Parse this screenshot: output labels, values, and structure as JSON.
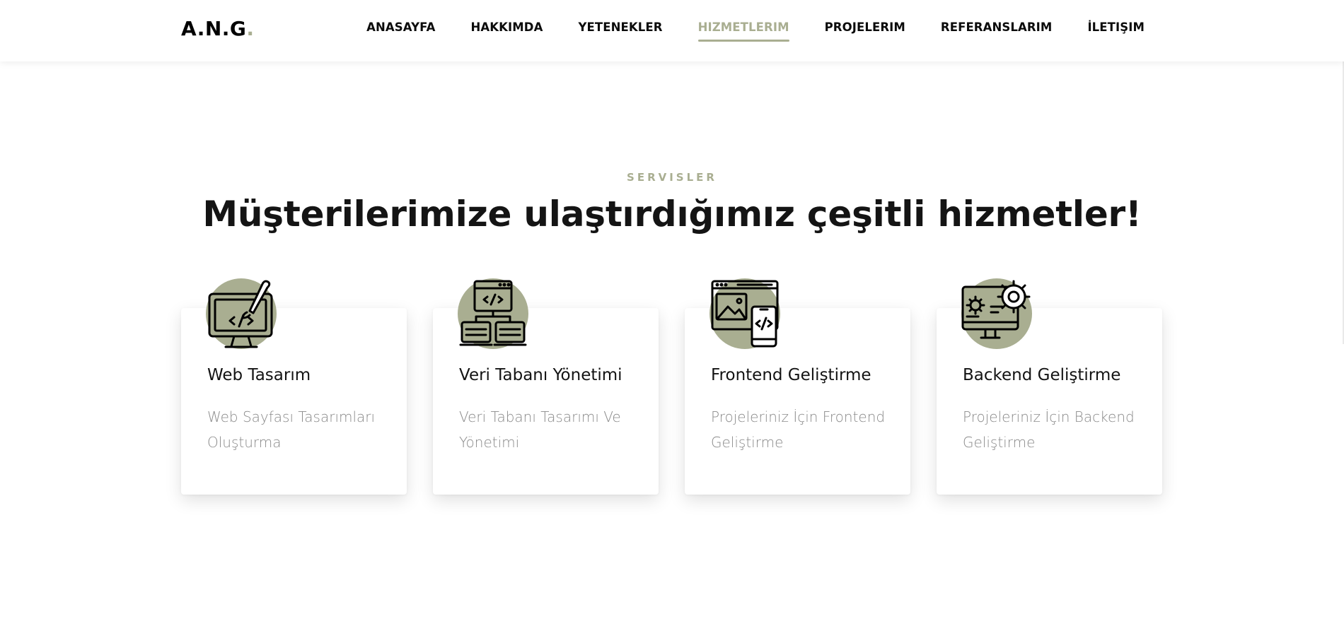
{
  "header": {
    "logo": {
      "text": "A.N.G",
      "dot": "."
    },
    "nav": [
      {
        "label": "ANASAYFA",
        "active": false
      },
      {
        "label": "HAKKIMDA",
        "active": false
      },
      {
        "label": "YETENEKLER",
        "active": false
      },
      {
        "label": "HIZMETLERIM",
        "active": true
      },
      {
        "label": "PROJELERIM",
        "active": false
      },
      {
        "label": "REFERANSLARIM",
        "active": false
      },
      {
        "label": "İLETIŞIM",
        "active": false
      }
    ]
  },
  "services": {
    "eyebrow": "SERVISLER",
    "headline": "Müşterilerimize ulaştırdığımız çeşitli hizmetler!",
    "cards": [
      {
        "icon": "web-design-icon",
        "title": "Web Tasarım",
        "desc_line1": "Web Sayfası Tasarımları",
        "desc_line2": "Oluşturma"
      },
      {
        "icon": "database-management-icon",
        "title": "Veri Tabanı Yönetimi",
        "desc_line1": "Veri Tabanı Tasarımı Ve",
        "desc_line2": "Yönetimi"
      },
      {
        "icon": "frontend-development-icon",
        "title": "Frontend Geliştirme",
        "desc_line1": "Projeleriniz İçin Frontend",
        "desc_line2": "Geliştirme"
      },
      {
        "icon": "backend-development-icon",
        "title": "Backend Geliştirme",
        "desc_line1": "Projeleriniz İçin Backend",
        "desc_line2": "Geliştirme"
      }
    ]
  },
  "colors": {
    "accent": "#a9ae91",
    "text": "#141414",
    "muted": "#8a8a8a",
    "background": "#ffffff"
  }
}
